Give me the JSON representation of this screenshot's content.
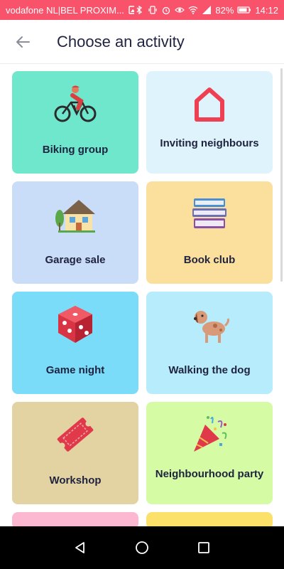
{
  "status_bar": {
    "carrier": "vodafone NL|BEL PROXIM...",
    "battery": "82%",
    "time": "14:12",
    "bg_color": "#f8536b"
  },
  "header": {
    "title": "Choose an activity",
    "back_icon": "arrow-left-icon"
  },
  "activities": [
    {
      "label": "Biking group",
      "icon": "cyclist-icon",
      "color": "#6ee7cd"
    },
    {
      "label": "Inviting neighbours",
      "icon": "home-outline-icon",
      "color": "#dff3fd"
    },
    {
      "label": "Garage sale",
      "icon": "house-icon",
      "color": "#c9dcf8"
    },
    {
      "label": "Book club",
      "icon": "books-icon",
      "color": "#fbe09d"
    },
    {
      "label": "Game night",
      "icon": "dice-icon",
      "color": "#7bdcf9"
    },
    {
      "label": "Walking the dog",
      "icon": "dog-icon",
      "color": "#b6ecfb"
    },
    {
      "label": "Workshop",
      "icon": "ticket-icon",
      "color": "#e3d3a2"
    },
    {
      "label": "Neighbourhood party",
      "icon": "party-popper-icon",
      "color": "#d5fba4"
    },
    {
      "label": "",
      "icon": "",
      "color": "#fbb8d0"
    },
    {
      "label": "",
      "icon": "",
      "color": "#fbe06a"
    }
  ],
  "nav_bar": {
    "back": "nav-back-icon",
    "home": "nav-home-icon",
    "recents": "nav-recents-icon"
  }
}
